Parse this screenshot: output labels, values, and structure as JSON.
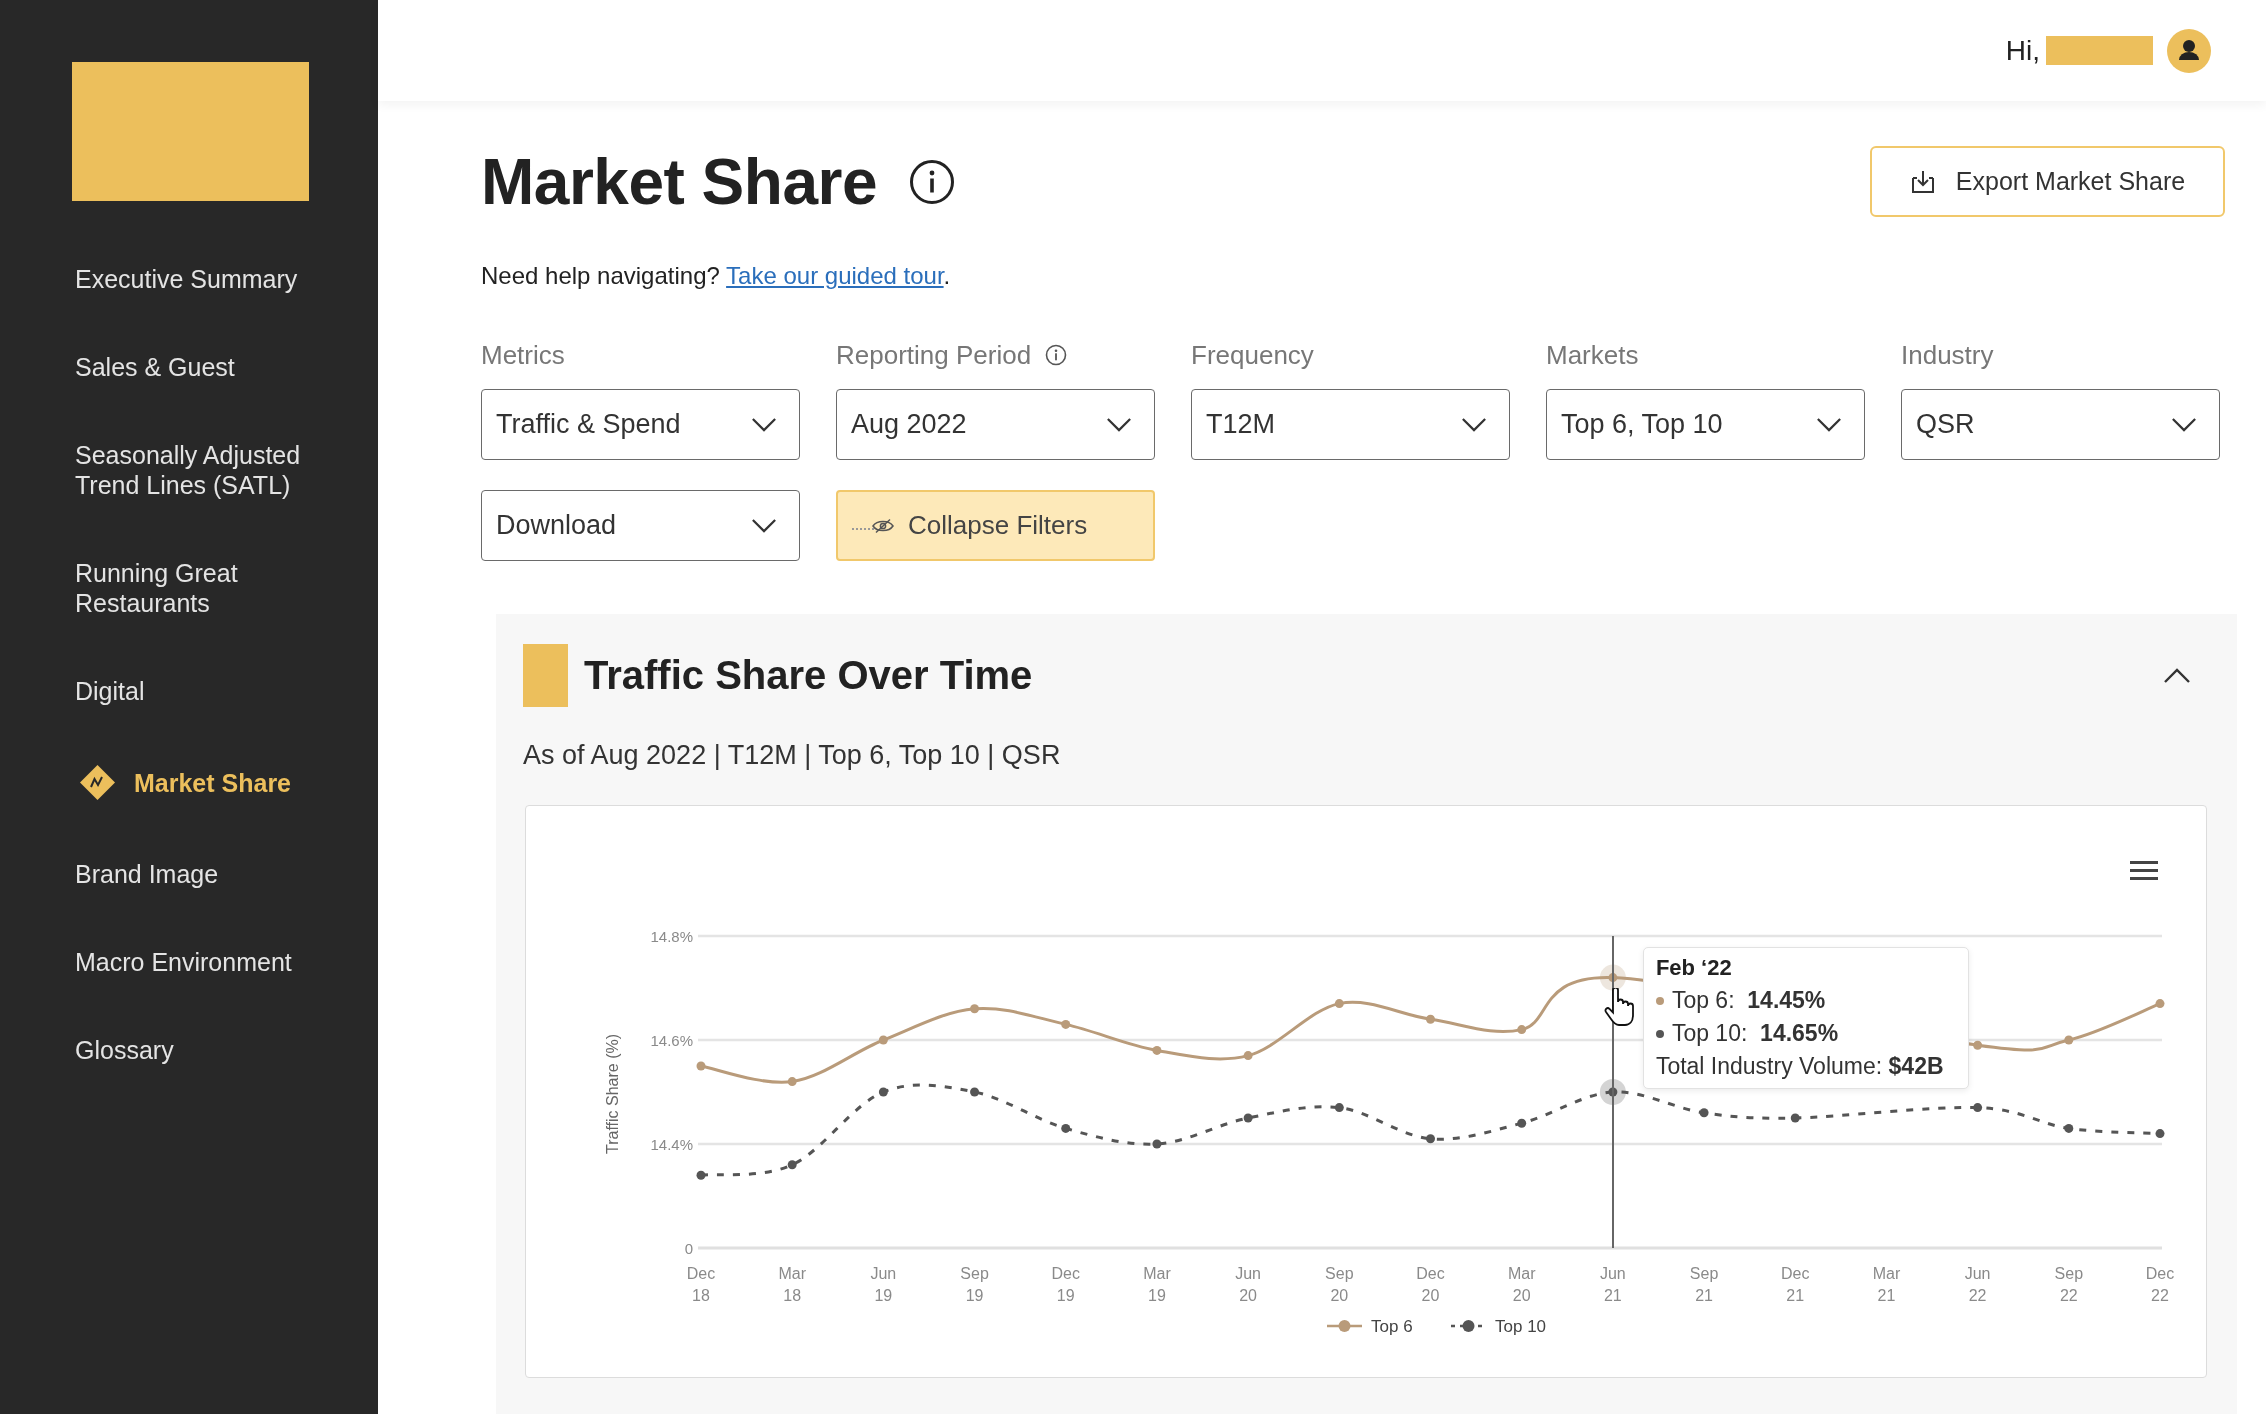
{
  "sidebar": {
    "nav": [
      {
        "label": "Executive Summary",
        "selected": false
      },
      {
        "label": "Sales & Guest",
        "selected": false
      },
      {
        "label": "Seasonally Adjusted Trend Lines (SATL)",
        "selected": false
      },
      {
        "label": "Running Great Restaurants",
        "selected": false
      },
      {
        "label": "Digital",
        "selected": false
      },
      {
        "label": "Market Share",
        "selected": true
      },
      {
        "label": "Brand Image",
        "selected": false
      },
      {
        "label": "Macro Environment",
        "selected": false
      },
      {
        "label": "Glossary",
        "selected": false
      }
    ]
  },
  "header": {
    "greeting": "Hi,"
  },
  "page": {
    "title": "Market Share",
    "export_button": "Export Market Share",
    "help": {
      "text": "Need help navigating?",
      "link": "Take our guided tour",
      "after": "."
    }
  },
  "filters": [
    {
      "label": "Metrics",
      "value": "Traffic & Spend",
      "info": false
    },
    {
      "label": "Reporting Period",
      "value": "Aug 2022",
      "info": true
    },
    {
      "label": "Frequency",
      "value": "T12M",
      "info": false
    },
    {
      "label": "Markets",
      "value": "Top 6, Top 10",
      "info": false
    },
    {
      "label": "Industry",
      "value": "QSR",
      "info": false
    }
  ],
  "download_select": {
    "value": "Download"
  },
  "collapse_button": {
    "label": "Collapse Filters"
  },
  "traffic_card": {
    "title": "Traffic Share Over Time",
    "expanded": true,
    "subtitle": "As of Aug 2022 | T12M | Top 6, Top 10 | QSR",
    "chart_data": {
      "type": "line",
      "ylabel": "Traffic Share (%)",
      "categories": [
        "Dec 18",
        "Mar 18",
        "Jun 19",
        "Sep 19",
        "Dec 19",
        "Mar 19",
        "Jun 20",
        "Sep 20",
        "Dec 20",
        "Mar 20",
        "Jun 21",
        "Sep 21",
        "Dec 21",
        "Mar 21",
        "Jun 22",
        "Sep 22",
        "Dec 22"
      ],
      "series": [
        {
          "name": "Top 6",
          "color": "#b99b7a",
          "line_style": "solid",
          "marker": "circle",
          "values": [
            14.55,
            14.52,
            14.6,
            14.66,
            14.63,
            14.58,
            14.57,
            14.67,
            14.64,
            14.62,
            14.72,
            null,
            null,
            null,
            14.59,
            14.6,
            14.67
          ]
        },
        {
          "name": "Top 10",
          "color": "#555555",
          "line_style": "dashed",
          "marker": "circle",
          "values": [
            14.34,
            14.36,
            14.5,
            14.5,
            14.43,
            14.4,
            14.45,
            14.47,
            14.41,
            14.44,
            14.5,
            14.46,
            14.45,
            null,
            14.47,
            14.43,
            14.42
          ]
        }
      ],
      "ylim": [
        14.2,
        14.8
      ],
      "yticks": [
        {
          "value": 14.4,
          "label": "14.4%"
        },
        {
          "value": 14.6,
          "label": "14.6%"
        },
        {
          "value": 14.8,
          "label": "14.8%"
        }
      ],
      "legend": "bottom"
    },
    "axis_break_label": "0",
    "tooltip": {
      "title": "Feb ‘22",
      "rows": [
        {
          "text": "Top 6:  **14.45%**",
          "color": "#b99b7a"
        },
        {
          "text": "Top 10:  **14.65%**",
          "color": "#555555"
        }
      ],
      "footer": "Total Industry Volume: **$42B**"
    }
  }
}
